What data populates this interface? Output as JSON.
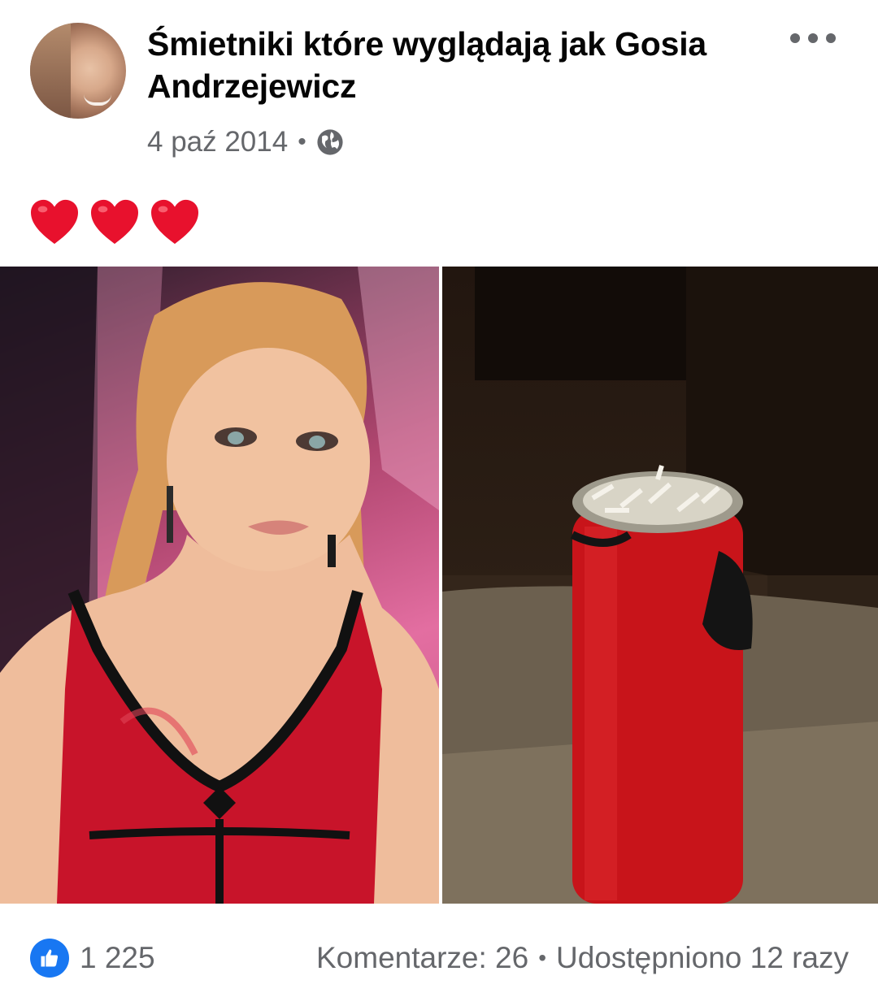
{
  "post": {
    "author": "Śmietniki które wyglądają jak Gosia Andrzejewicz",
    "date": "4 paź 2014",
    "separator": "•",
    "privacy_icon": "globe-icon",
    "more_icon": "more-options-icon",
    "text_emoji": [
      "heart-emoji",
      "heart-emoji",
      "heart-emoji"
    ],
    "heart_color": "#e8112d"
  },
  "media": {
    "left_image": "woman-in-red-top-photo",
    "right_image": "red-ashtray-bin-photo"
  },
  "footer": {
    "like_icon": "like-thumb-icon",
    "like_color": "#1877f2",
    "likes": "1 225",
    "comments": "Komentarze: 26",
    "separator": "•",
    "shares": "Udostępniono 12 razy"
  }
}
